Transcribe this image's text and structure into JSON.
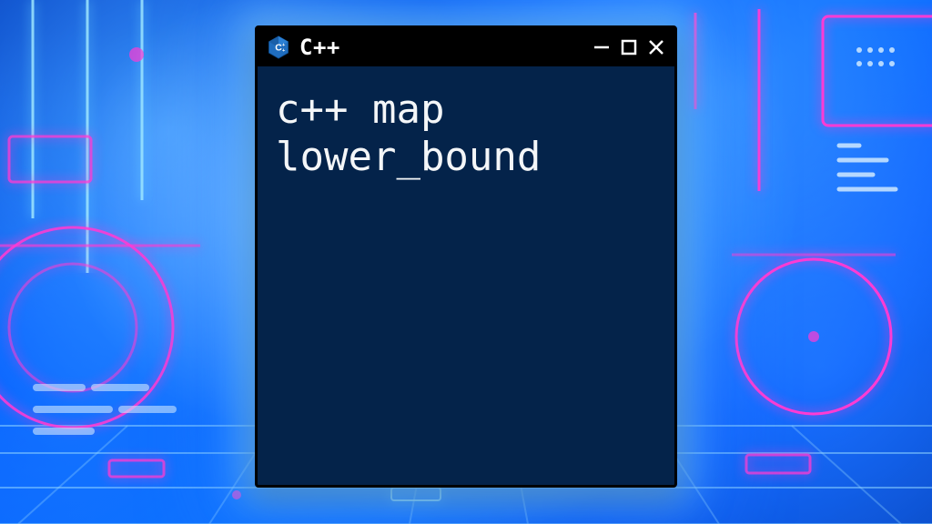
{
  "window": {
    "title": "C++",
    "icon_name": "cpp-logo-icon",
    "content_line1": "c++ map",
    "content_line2": "lower_bound"
  },
  "colors": {
    "terminal_bg": "#04234a",
    "accent_magenta": "#ff3bd4",
    "accent_cyan": "#9fe8ff",
    "glow": "#78c8ff"
  }
}
